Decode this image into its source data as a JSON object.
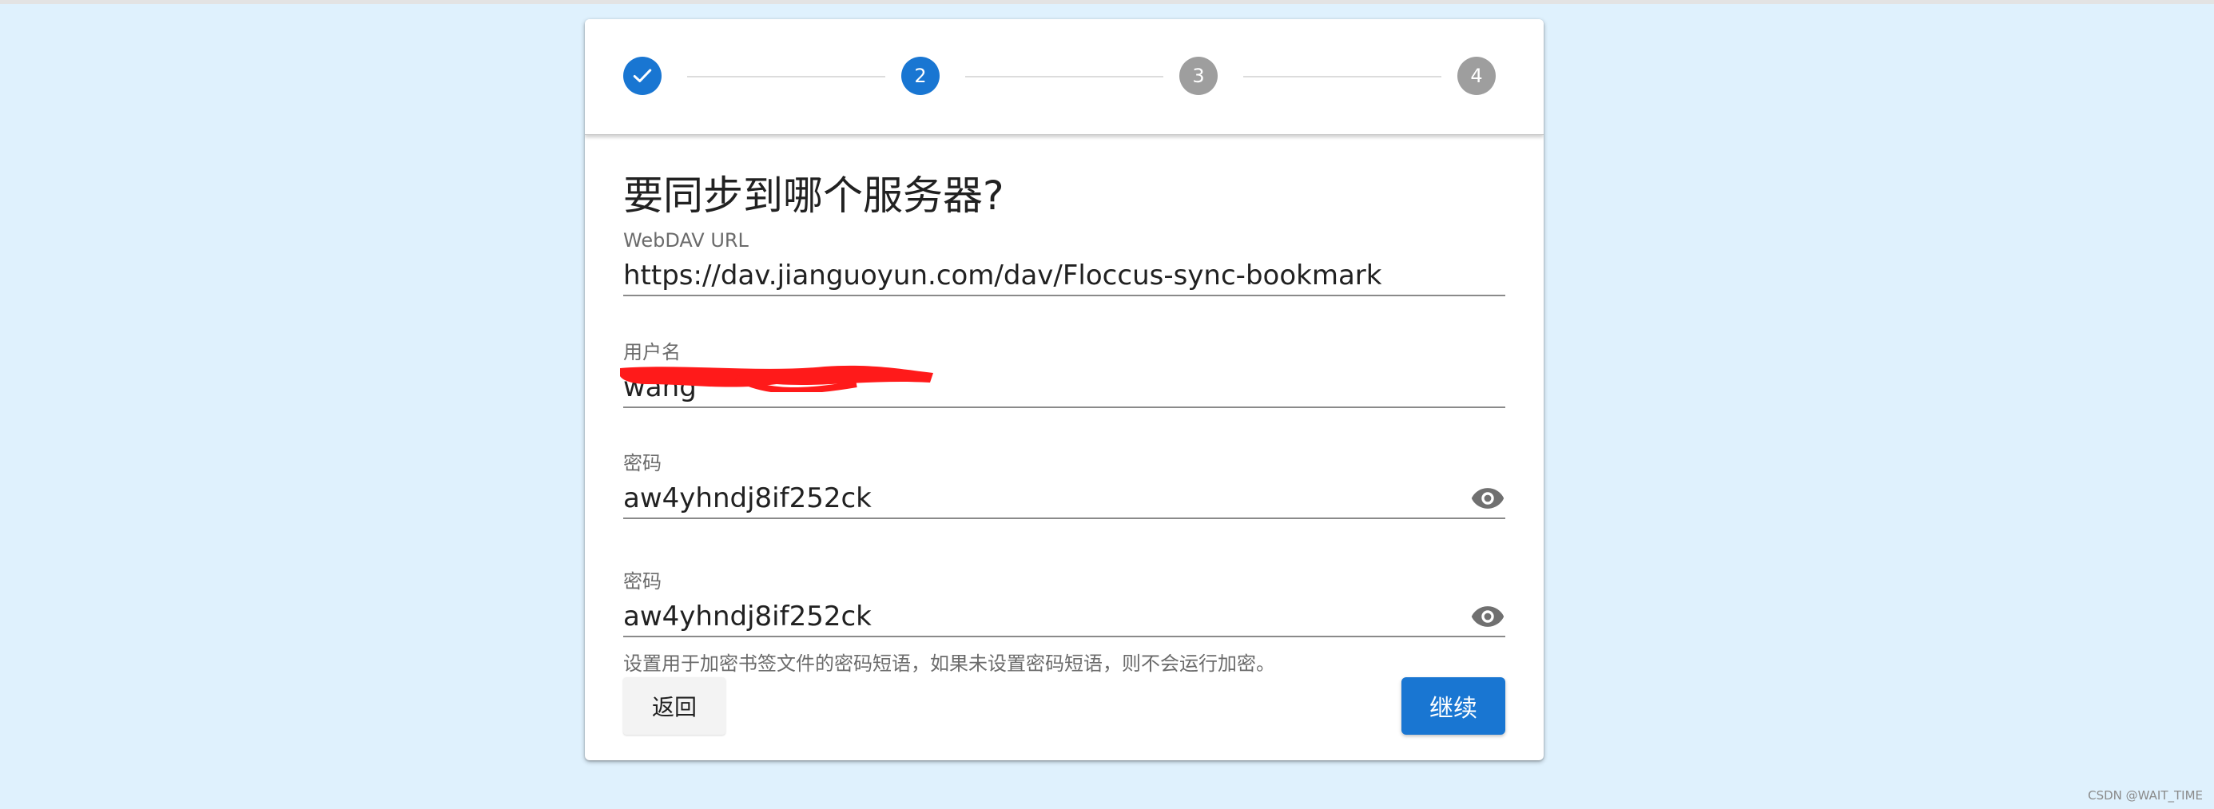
{
  "stepper": {
    "steps": [
      {
        "number": "",
        "state": "done",
        "icon": "check-icon"
      },
      {
        "number": "2",
        "state": "active"
      },
      {
        "number": "3",
        "state": "pending"
      },
      {
        "number": "4",
        "state": "pending"
      }
    ]
  },
  "form": {
    "title": "要同步到哪个服务器?",
    "webdav_url": {
      "label": "WebDAV URL",
      "value": "https://dav.jianguoyun.com/dav/Floccus-sync-bookmark"
    },
    "username": {
      "label": "用户名",
      "value": "wang"
    },
    "password": {
      "label": "密码",
      "value": "aw4yhndj8if252ck"
    },
    "passphrase": {
      "label": "密码",
      "value": "aw4yhndj8if252ck"
    },
    "hint": "设置用于加密书签文件的密码短语，如果未设置密码短语，则不会运行加密。"
  },
  "actions": {
    "back_label": "返回",
    "continue_label": "继续"
  },
  "watermark": "CSDN @WAIT_TIME",
  "colors": {
    "accent": "#1976d2",
    "pending_step": "#9e9e9e",
    "background": "#dff1fd",
    "redaction": "#ff1a1a"
  }
}
